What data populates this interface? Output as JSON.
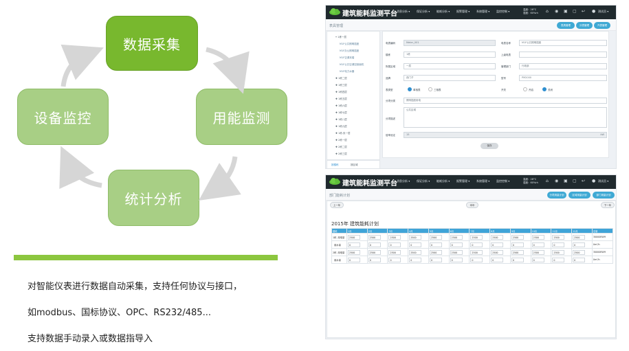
{
  "cycle": {
    "top": "数据采集",
    "right": "用能监测",
    "bottom": "统计分析",
    "left": "设备监控"
  },
  "description": [
    "对智能仪表进行数据自动采集，支持任何协议与接口，",
    "如modbus、国标协议、OPC、RS232/485...",
    "支持数据手动录入或数据指导入"
  ],
  "colors": {
    "accent_green": "#78b82e",
    "pale_green": "#a8cf85",
    "header_dark": "#202a2e",
    "accent_blue": "#3fa9d4"
  },
  "app": {
    "brand": "建筑能耗监测平台",
    "menus": [
      "消息分析 ▾",
      "保证分析 ▾",
      "能耗分析 ▾",
      "报警管理 ▾",
      "系统管理 ▾",
      "监控控制 ▾"
    ],
    "temp": "温度：28°C",
    "humid": "湿度：60%rh",
    "user": "测试员 ▾",
    "icons": [
      "home-icon",
      "alarm-icon",
      "lock-icon",
      "message-icon",
      "back-icon",
      "user-icon"
    ]
  },
  "meter_screen": {
    "page_title": "表具管理",
    "buttons": [
      "表具管理",
      "分表管理",
      "汽表管理"
    ],
    "tree": [
      "━ 1栋一层",
      "M1F公共照明插座",
      "M1F办公照明插座",
      "M1F空调末端",
      "M1F公共空调控制面机",
      "M1F电力水器",
      "✚ 1栋二层",
      "✚ 1栋三层",
      "✚ 1栋四层",
      "✚ 1栋五层",
      "✚ 1栋六层",
      "✚ 1栋七层",
      "✚ 1栋八层",
      "✚ 1栋九层",
      "✚ 1栋-负一层",
      "✚ 2栋一层",
      "✚ 2栋二层",
      "✚ 2栋三层"
    ],
    "tabs": [
      "按楼栋",
      "按区域"
    ],
    "fields": {
      "meter_code_label": "电表编码",
      "meter_code": "Meter_001",
      "meter_name_label": "电表名称",
      "meter_name": "M1F公共照明插座",
      "building_label": "楼栋",
      "building": "1栋",
      "upper_meter_label": "上级电表",
      "upper_meter": "",
      "floor_label": "所属区域",
      "floor": "一层",
      "dept_label": "管理部门",
      "dept": "行政部",
      "brand_label": "品牌",
      "brand": "西门子",
      "model_label": "型号",
      "model": "PM2000",
      "type_label": "表类型",
      "type_opt1": "单相表",
      "type_opt2": "三相表",
      "switch_label": "开关",
      "switch_opt1": "开启",
      "switch_opt2": "关闭",
      "category_label": "分项分类",
      "category": "照明插座用电",
      "remark_label": "分项描述",
      "remark": "公共区域",
      "ratio_label": "倍率设定",
      "ratio": "15",
      "ratio_unit": "kW"
    },
    "save": "保存"
  },
  "plan_screen": {
    "page_title": "部门能耗计划",
    "buttons": [
      "分项用量计划",
      "区域用量计划",
      "部门用量计划"
    ],
    "prev": "上一年",
    "year_btn": "本年",
    "next": "下一年",
    "table_title": "2015年 建筑能耗计划",
    "columns": [
      "楼栋",
      "1月",
      "2月",
      "3月",
      "4月",
      "5月",
      "6月",
      "7月",
      "8月",
      "9月",
      "10月",
      "11月",
      "12月",
      "总量"
    ],
    "rows": [
      {
        "building": "1栋",
        "type": "用电量",
        "values": [
          "2500",
          "2500",
          "2500",
          "2500",
          "2500",
          "2500",
          "2500",
          "2500",
          "2500",
          "2500",
          "2500",
          "2500"
        ],
        "total": "30000KWH"
      },
      {
        "building": "",
        "type": "用水量",
        "values": [
          "0",
          "0",
          "0",
          "0",
          "0",
          "0",
          "0",
          "0",
          "0",
          "0",
          "0",
          "0"
        ],
        "total": "0m³/h"
      },
      {
        "building": "2栋",
        "type": "用电量",
        "values": [
          "2500",
          "2500",
          "2500",
          "2500",
          "2500",
          "2500",
          "2500",
          "2500",
          "2500",
          "2500",
          "2500",
          "2500"
        ],
        "total": "30000KWH"
      },
      {
        "building": "",
        "type": "用水量",
        "values": [
          "0",
          "0",
          "0",
          "0",
          "0",
          "0",
          "0",
          "0",
          "0",
          "0",
          "0",
          "0"
        ],
        "total": "0m³/h"
      }
    ]
  }
}
